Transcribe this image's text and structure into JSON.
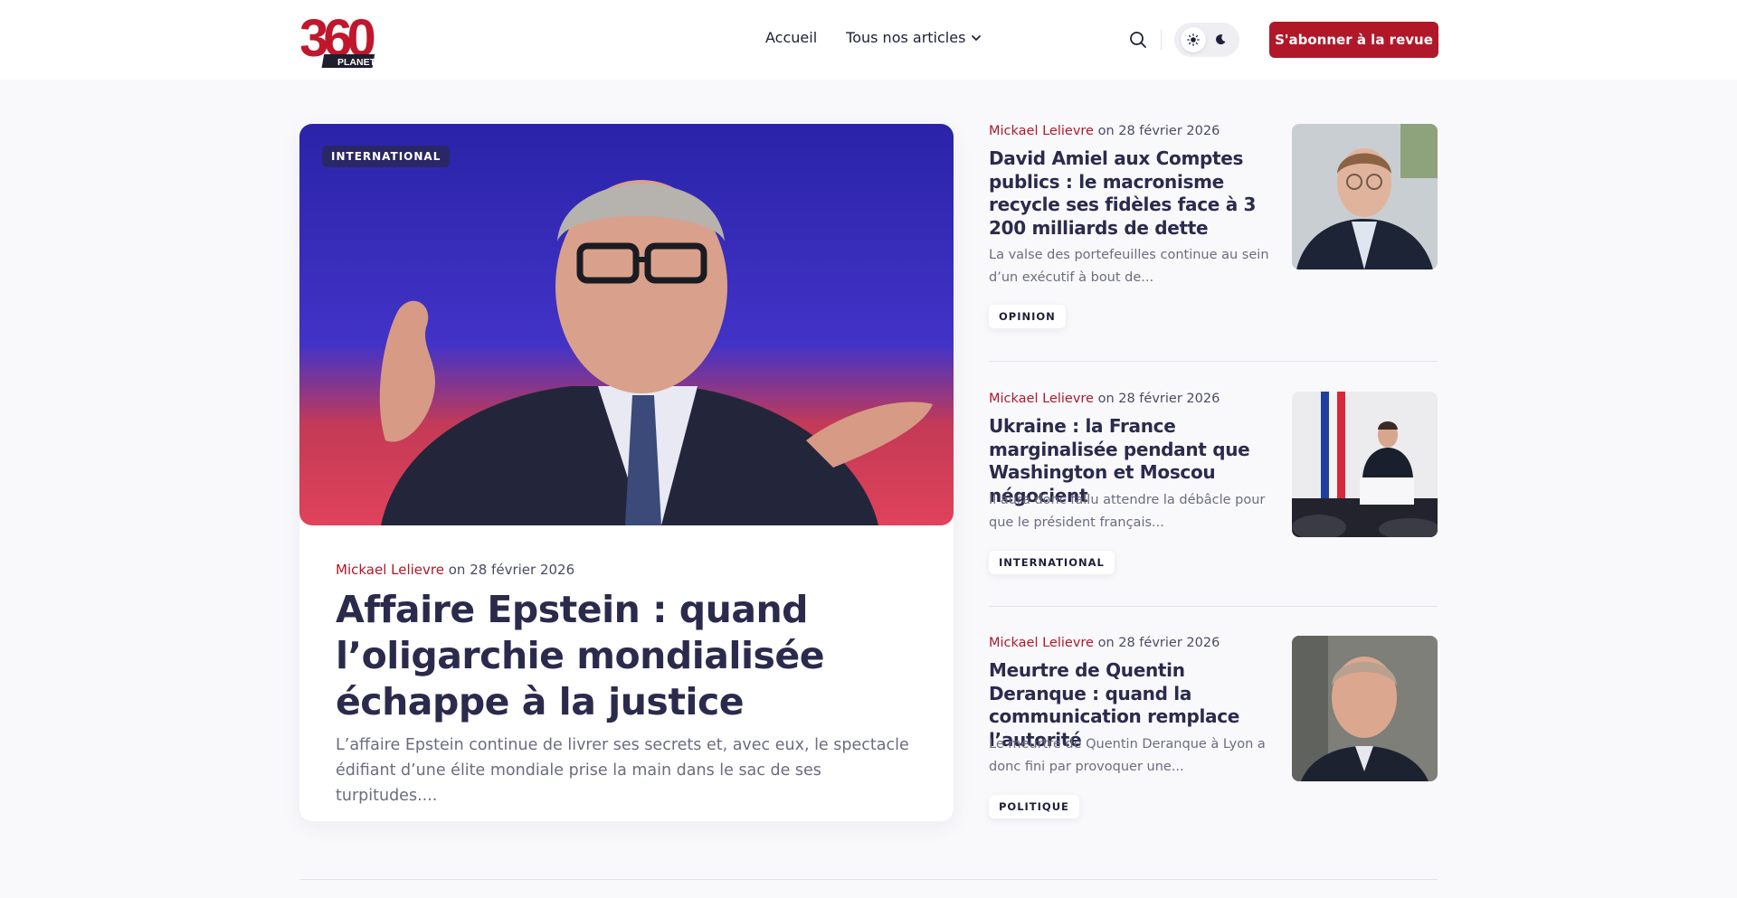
{
  "header": {
    "logo": {
      "number": "360",
      "word": "PLANETES"
    },
    "nav": [
      {
        "label": "Accueil"
      },
      {
        "label": "Tous nos articles"
      }
    ],
    "subscribe_label": "S'abonner à la revue"
  },
  "featured": {
    "tag": "INTERNATIONAL",
    "author": "Mickael Lelievre",
    "date": "on 28 février 2026",
    "title": "Affaire Epstein : quand l’oligarchie mondialisée échappe à la justice",
    "excerpt": "L’affaire Epstein continue de livrer ses secrets et, avec eux, le spectacle édifiant d’une élite mondiale prise la main dans le sac de ses turpitudes...."
  },
  "articles": [
    {
      "author": "Mickael Lelievre",
      "date": "on 28 février 2026",
      "title": "David Amiel aux Comptes publics : le macronisme recycle ses fidèles face à 3 200 milliards de dette",
      "excerpt": "La valse des portefeuilles continue au sein d’un exécutif à bout de...",
      "tag": "OPINION"
    },
    {
      "author": "Mickael Lelievre",
      "date": "on 28 février 2026",
      "title": "Ukraine : la France marginalisée pendant que Washington et Moscou négocient",
      "excerpt": "Il aura donc fallu attendre la débâcle pour que le président français...",
      "tag": "INTERNATIONAL"
    },
    {
      "author": "Mickael Lelievre",
      "date": "on 28 février 2026",
      "title": "Meurtre de Quentin Deranque : quand la communication remplace l’autorité",
      "excerpt": "Le meurtre de Quentin Deranque à Lyon a donc fini par provoquer une...",
      "tag": "POLITIQUE"
    }
  ],
  "colors": {
    "accent": "#b0182a",
    "title": "#2a2b4c",
    "text_muted": "#6b6c80",
    "background": "#f9f9fc"
  }
}
